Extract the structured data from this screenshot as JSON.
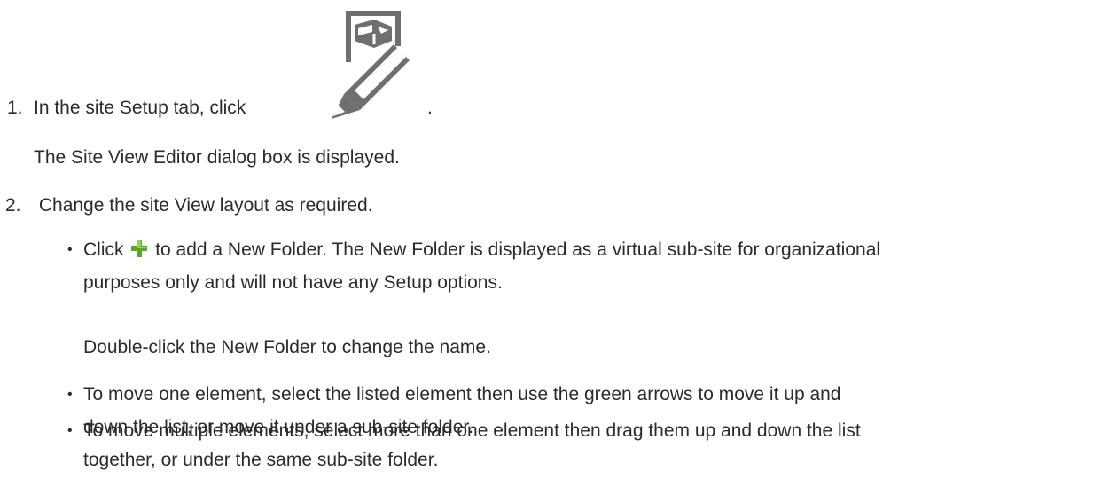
{
  "steps": [
    {
      "number": "1.",
      "text": "In the site Setup tab, click",
      "icon": "site-view-edit-icon",
      "trailing": ".",
      "result": "The Site View Editor dialog box is displayed."
    },
    {
      "number": "2.",
      "text": "Change the site View layout as required."
    }
  ],
  "bullets": [
    {
      "prefix": "Click",
      "icon": "green-plus-icon",
      "line1": "to add a New Folder. The New Folder is displayed as a virtual sub-site for organizational",
      "line2": "purposes only and will not have any Setup options.",
      "note": "Double-click the New Folder to change the name."
    },
    {
      "line1": "To move one element, select the listed element then use the green arrows to move it up and",
      "line2": "down the list, or move it under a sub-site folder."
    },
    {
      "line1": "To move multiple elements, select more than one element then drag them up and down the list",
      "line2": "together, or under the same sub-site folder."
    }
  ],
  "colors": {
    "text": "#2b2b2b",
    "icon_gray": "#6f6f6f",
    "plus_green": "#5aa82a"
  }
}
